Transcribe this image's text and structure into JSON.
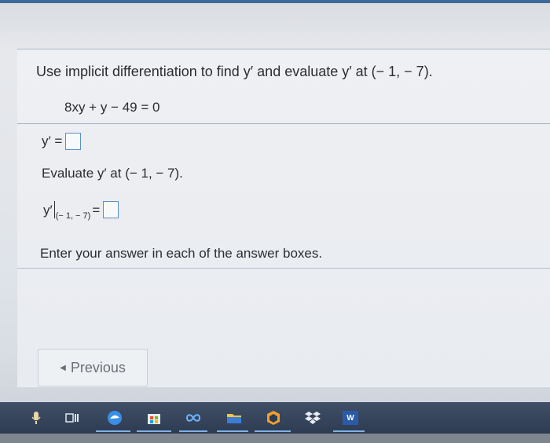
{
  "question": {
    "text": "Use implicit differentiation to find y′ and evaluate y′ at (− 1, − 7).",
    "equation": "8xy + y − 49 = 0"
  },
  "answer1": {
    "label": "y′ ="
  },
  "evaluate": {
    "text": "Evaluate y′ at (− 1, − 7).",
    "label": "y′",
    "subscript": "(− 1, − 7)",
    "equals": "="
  },
  "instruction": "Enter your answer in each of the answer boxes.",
  "nav": {
    "previous_label": "Previous"
  },
  "taskbar": {
    "icons": [
      "microphone-icon",
      "task-view-icon",
      "edge-browser-icon",
      "store-icon",
      "infinity-icon",
      "file-explorer-icon",
      "office-icon",
      "dropbox-icon",
      "word-icon"
    ],
    "word_label": "W"
  }
}
